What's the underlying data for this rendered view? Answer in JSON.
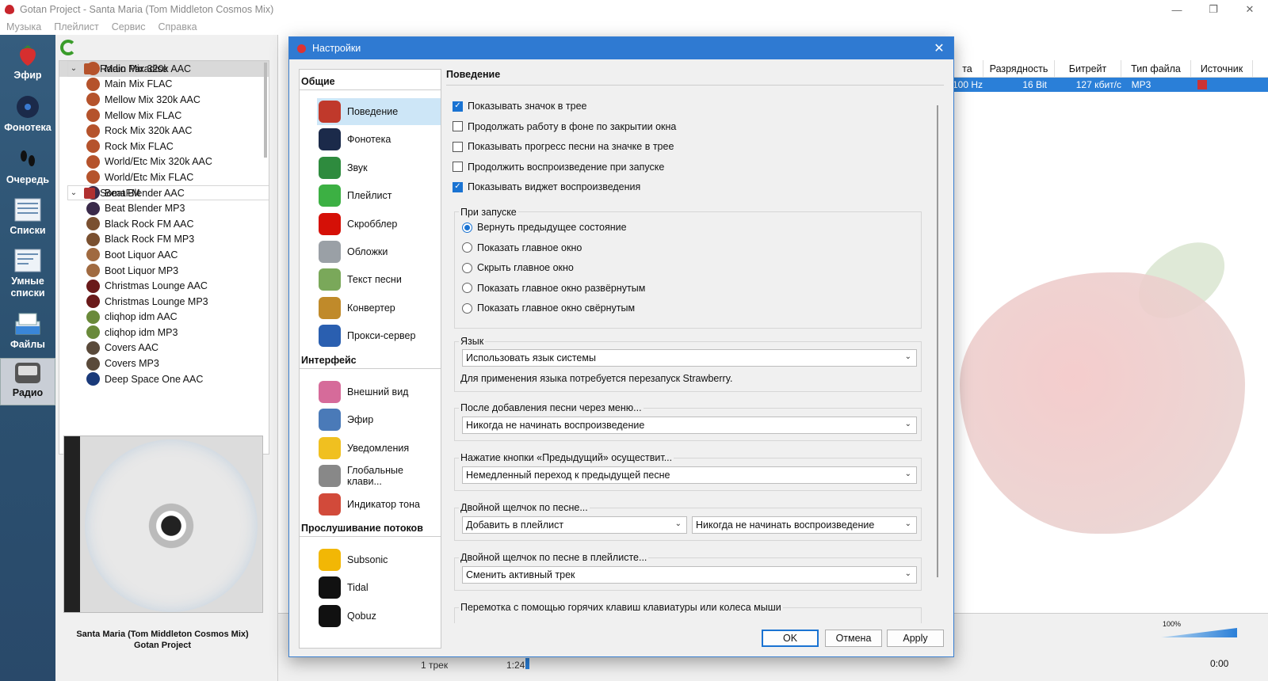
{
  "window": {
    "title": "Gotan Project - Santa Maria (Tom Middleton Cosmos Mix)",
    "controls": [
      "—",
      "❐",
      "✕"
    ]
  },
  "menu": [
    "Музыка",
    "Плейлист",
    "Сервис",
    "Справка"
  ],
  "sidebar": [
    {
      "label": "Эфир",
      "icon": "strawberry-icon"
    },
    {
      "label": "Фонотека",
      "icon": "vinyl-icon"
    },
    {
      "label": "Очередь",
      "icon": "footsteps-icon"
    },
    {
      "label": "Списки",
      "icon": "playlists-icon"
    },
    {
      "label": "Умные списки",
      "icon": "smart-playlists-icon"
    },
    {
      "label": "Файлы",
      "icon": "files-icon"
    },
    {
      "label": "Радио",
      "icon": "radio-icon"
    }
  ],
  "tree": [
    {
      "label": "Radio Paradise",
      "group": true,
      "color": "#b5532c"
    },
    {
      "label": "Main Mix 320k AAC",
      "selected": true,
      "color": "#b5532c"
    },
    {
      "label": "Main Mix FLAC",
      "color": "#b5532c"
    },
    {
      "label": "Mellow Mix 320k AAC",
      "color": "#b5532c"
    },
    {
      "label": "Mellow Mix FLAC",
      "color": "#b5532c"
    },
    {
      "label": "Rock Mix 320k AAC",
      "color": "#b5532c"
    },
    {
      "label": "Rock Mix FLAC",
      "color": "#b5532c"
    },
    {
      "label": "World/Etc Mix 320k AAC",
      "color": "#b5532c"
    },
    {
      "label": "World/Etc Mix FLAC",
      "color": "#b5532c"
    },
    {
      "label": "SomaFM",
      "group": true,
      "color": "#b03030"
    },
    {
      "label": "Beat Blender AAC",
      "color": "#3a2a4a"
    },
    {
      "label": "Beat Blender MP3",
      "color": "#3a2a4a"
    },
    {
      "label": "Black Rock FM AAC",
      "color": "#7a5030"
    },
    {
      "label": "Black Rock FM MP3",
      "color": "#7a5030"
    },
    {
      "label": "Boot Liquor AAC",
      "color": "#a06a40"
    },
    {
      "label": "Boot Liquor MP3",
      "color": "#a06a40"
    },
    {
      "label": "Christmas Lounge AAC",
      "color": "#6a1a1a"
    },
    {
      "label": "Christmas Lounge MP3",
      "color": "#6a1a1a"
    },
    {
      "label": "cliqhop idm AAC",
      "color": "#6a8a3a"
    },
    {
      "label": "cliqhop idm MP3",
      "color": "#6a8a3a"
    },
    {
      "label": "Covers AAC",
      "color": "#5a4a3a"
    },
    {
      "label": "Covers MP3",
      "color": "#5a4a3a"
    },
    {
      "label": "Deep Space One AAC",
      "color": "#1a3a7a"
    }
  ],
  "now_playing": {
    "title": "Santa Maria (Tom Middleton Cosmos Mix)",
    "artist": "Gotan Project"
  },
  "playlist": {
    "headers": [
      "та",
      "Разрядность",
      "Битрейт",
      "Тип файла",
      "Источник"
    ],
    "row": [
      "100 Hz",
      "16 Bit",
      "127 кбит/с",
      "MP3",
      ""
    ]
  },
  "status": {
    "tracks": "1 трек",
    "position": "1:24",
    "time_end": "0:00",
    "volume": "100%"
  },
  "dialog": {
    "title": "Настройки",
    "close": "✕",
    "sections": [
      {
        "heading": "Общие",
        "items": [
          {
            "label": "Поведение",
            "icon": "behavior-icon",
            "color": "#c0392b",
            "active": true
          },
          {
            "label": "Фонотека",
            "icon": "library-icon",
            "color": "#1b2a4a"
          },
          {
            "label": "Звук",
            "icon": "sound-card-icon",
            "color": "#2e8b3e"
          },
          {
            "label": "Плейлист",
            "icon": "playlist-add-icon",
            "color": "#3cb043"
          },
          {
            "label": "Скробблер",
            "icon": "lastfm-icon",
            "color": "#d51007"
          },
          {
            "label": "Обложки",
            "icon": "covers-icon",
            "color": "#9aa0a6"
          },
          {
            "label": "Текст песни",
            "icon": "lyrics-icon",
            "color": "#7aa85a"
          },
          {
            "label": "Конвертер",
            "icon": "converter-icon",
            "color": "#c08a2a"
          },
          {
            "label": "Прокси-сервер",
            "icon": "proxy-icon",
            "color": "#2a5fb0"
          }
        ]
      },
      {
        "heading": "Интерфейс",
        "items": [
          {
            "label": "Внешний вид",
            "icon": "appearance-icon",
            "color": "#d66b9a"
          },
          {
            "label": "Эфир",
            "icon": "context-icon",
            "color": "#4a7ab8"
          },
          {
            "label": "Уведомления",
            "icon": "notifications-icon",
            "color": "#f0c020"
          },
          {
            "label": "Глобальные клави...",
            "icon": "keyboard-icon",
            "color": "#888888"
          },
          {
            "label": "Индикатор тона",
            "icon": "moodbar-icon",
            "color": "#d24a3a"
          }
        ]
      },
      {
        "heading": "Прослушивание потоков",
        "items": [
          {
            "label": "Subsonic",
            "icon": "subsonic-icon",
            "color": "#f2b705"
          },
          {
            "label": "Tidal",
            "icon": "tidal-icon",
            "color": "#111111"
          },
          {
            "label": "Qobuz",
            "icon": "qobuz-icon",
            "color": "#111111"
          }
        ]
      }
    ],
    "content": {
      "title": "Поведение",
      "checkboxes": [
        {
          "label": "Показывать значок в трее",
          "checked": true
        },
        {
          "label": "Продолжать работу в фоне по закрытии окна",
          "checked": false
        },
        {
          "label": "Показывать прогресс песни на значке в трее",
          "checked": false
        },
        {
          "label": "Продолжить воспроизведение при запуске",
          "checked": false
        },
        {
          "label": "Показывать виджет воспроизведения",
          "checked": true
        }
      ],
      "startup": {
        "label": "При запуске",
        "options": [
          {
            "label": "Вернуть предыдущее состояние",
            "checked": true
          },
          {
            "label": "Показать главное окно",
            "checked": false
          },
          {
            "label": "Скрыть главное окно",
            "checked": false
          },
          {
            "label": "Показать главное окно развёрнутым",
            "checked": false
          },
          {
            "label": "Показать главное окно свёрнутым",
            "checked": false
          }
        ]
      },
      "language": {
        "label": "Язык",
        "value": "Использовать язык системы",
        "note": "Для применения языка потребуется перезапуск Strawberry."
      },
      "after_add": {
        "label": "После добавления песни через меню...",
        "value": "Никогда не начинать воспроизведение"
      },
      "previous": {
        "label": "Нажатие кнопки «Предыдущий» осуществит...",
        "value": "Немедленный переход к предыдущей песне"
      },
      "double_click": {
        "label": "Двойной щелчок по песне...",
        "value1": "Добавить в плейлист",
        "value2": "Никогда не начинать воспроизведение"
      },
      "double_click_playlist": {
        "label": "Двойной щелчок по песне в плейлисте...",
        "value": "Сменить активный трек"
      },
      "seek": {
        "label": "Перемотка с помощью горячих клавиш клавиатуры или колеса мыши"
      }
    },
    "buttons": {
      "ok": "OK",
      "cancel": "Отмена",
      "apply": "Apply"
    }
  },
  "colors": {
    "accent": "#1a73d2",
    "titlebar": "#2f7ad2",
    "sidebar": "#2c5170"
  }
}
